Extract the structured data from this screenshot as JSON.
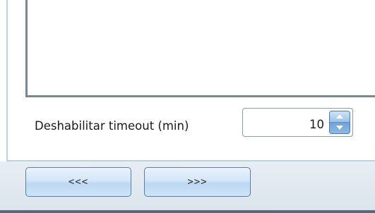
{
  "setting": {
    "label": "Deshabilitar timeout (min)",
    "value": "10"
  },
  "navigation": {
    "prev_label": "<<<",
    "next_label": ">>>"
  },
  "icons": {
    "spin_up": "chevron-up-icon",
    "spin_down": "chevron-down-icon"
  },
  "colors": {
    "panel_border": "#bcd3e6",
    "button_blue": "#bcd8f2",
    "toolbar_bg": "#e7edf3"
  }
}
